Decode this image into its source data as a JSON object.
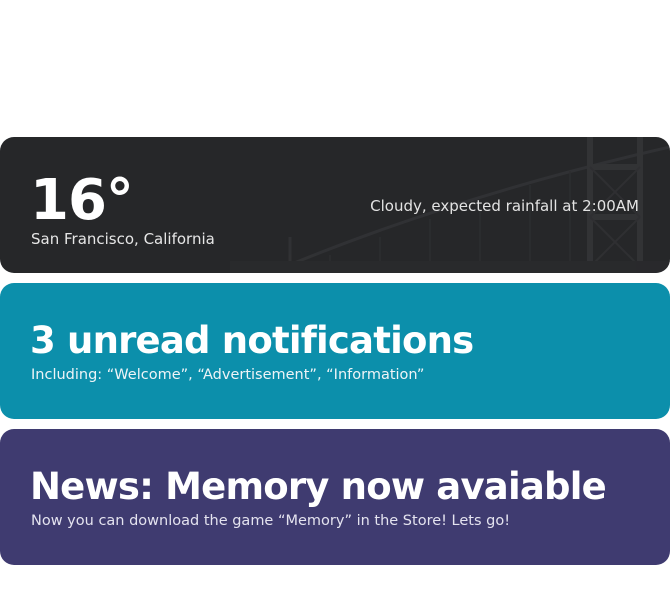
{
  "weather": {
    "temperature": "16°",
    "location": "San Francisco, California",
    "forecast": "Cloudy, expected rainfall at 2:00AM",
    "background_color": "#262729"
  },
  "notifications": {
    "title": "3 unread notifications",
    "subtitle": "Including: “Welcome”, “Advertisement”, “Information”",
    "background_color": "#0c8fab"
  },
  "news": {
    "title": "News: Memory now avaiable",
    "subtitle": "Now you can download the game “Memory” in the Store! Lets go!",
    "background_color": "#3f3b70"
  }
}
